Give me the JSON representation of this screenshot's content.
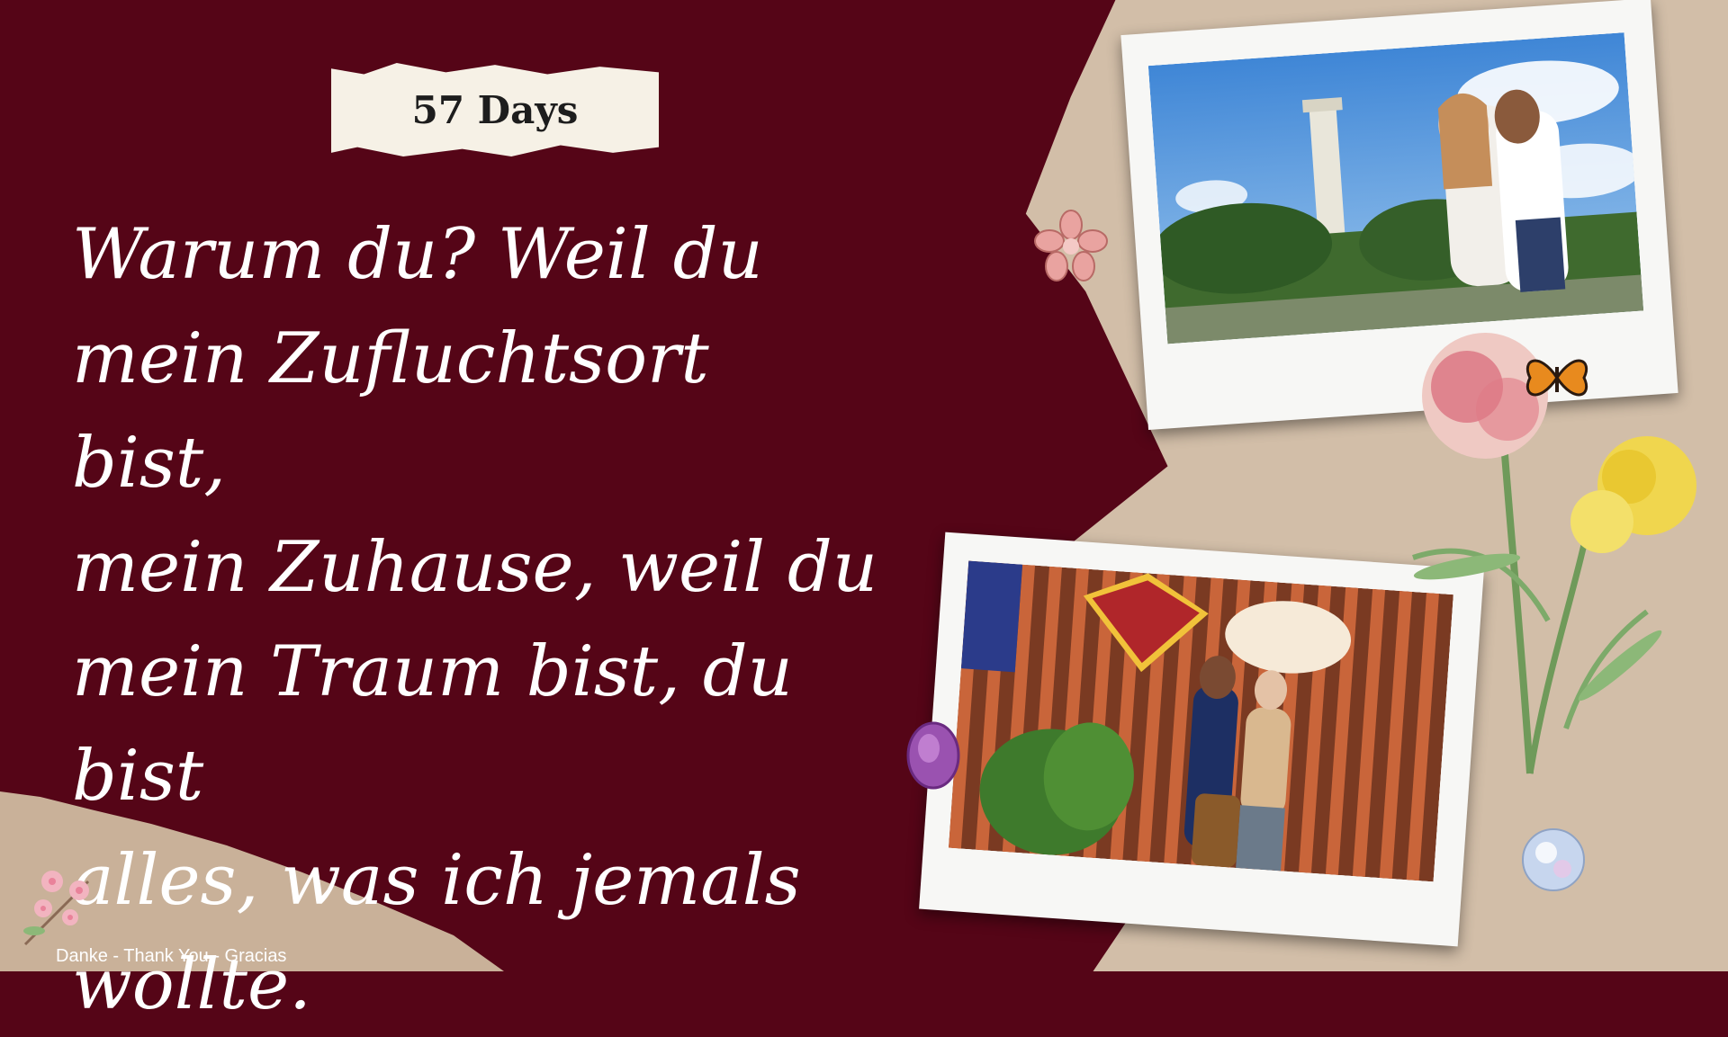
{
  "title_tag": "57 Days",
  "message": "Warum du? Weil du\nmein Zufluchtsort bist,\nmein Zuhause, weil du\nmein Traum bist, du bist\nalles, was ich jemals\nwollte.",
  "footer": "Danke - Thank You  - Gracias",
  "colors": {
    "background": "#550517",
    "paper": "#d9c8b0",
    "title_tag_bg": "#f6f1e6",
    "text": "#ffffff"
  }
}
